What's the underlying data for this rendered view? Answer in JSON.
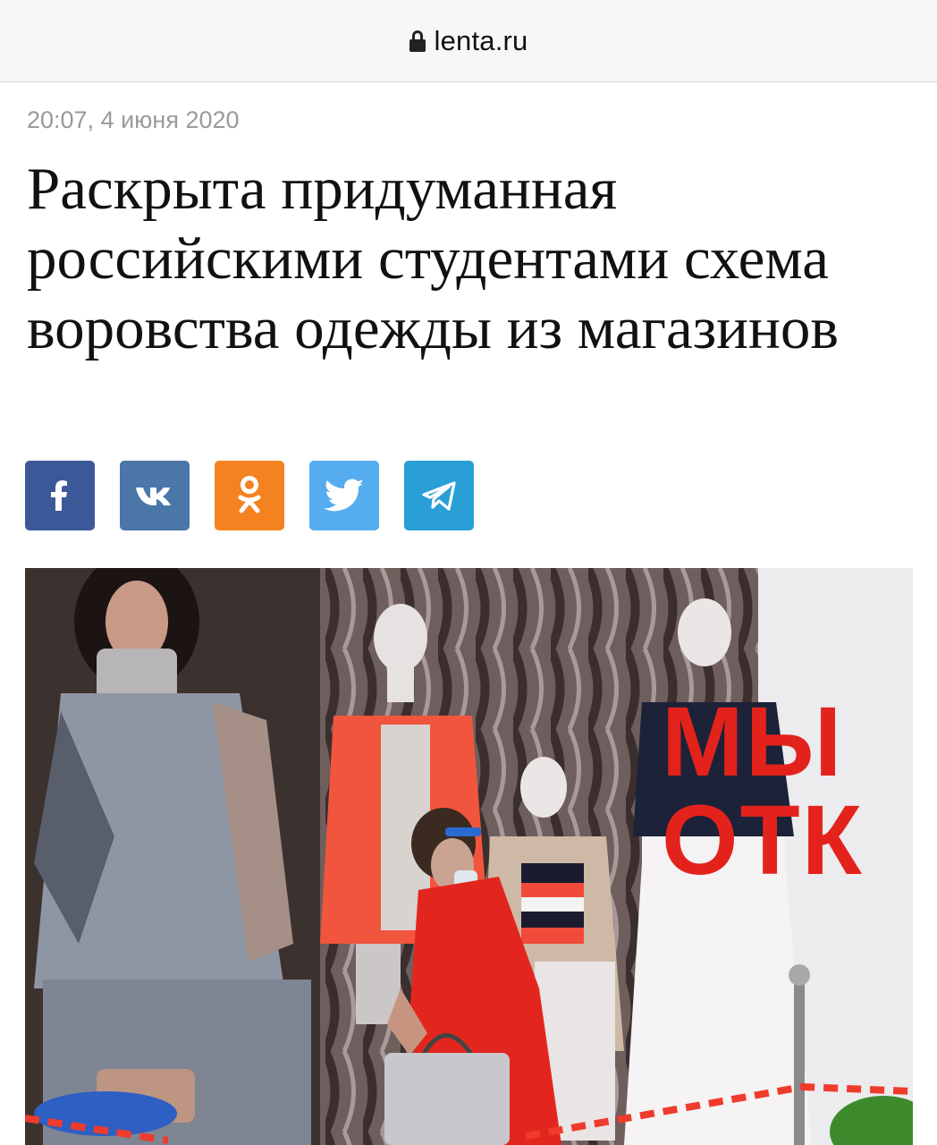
{
  "browser": {
    "url": "lenta.ru",
    "lock_icon": "lock-icon"
  },
  "article": {
    "timestamp": "20:07, 4 июня 2020",
    "headline": "Раскрыта придуманная российскими студентами схема воровства одежды из магазинов"
  },
  "share": {
    "buttons": [
      {
        "name": "facebook",
        "icon": "facebook-icon",
        "color": "#3b5998"
      },
      {
        "name": "vk",
        "icon": "vk-icon",
        "color": "#4a76a8"
      },
      {
        "name": "odnoklassniki",
        "icon": "odnoklassniki-icon",
        "color": "#f58220"
      },
      {
        "name": "twitter",
        "icon": "twitter-icon",
        "color": "#55acee"
      },
      {
        "name": "telegram",
        "icon": "telegram-icon",
        "color": "#2a9fd6"
      }
    ]
  },
  "photo": {
    "sign_line1": "МЫ",
    "sign_line2": "ОТК"
  }
}
